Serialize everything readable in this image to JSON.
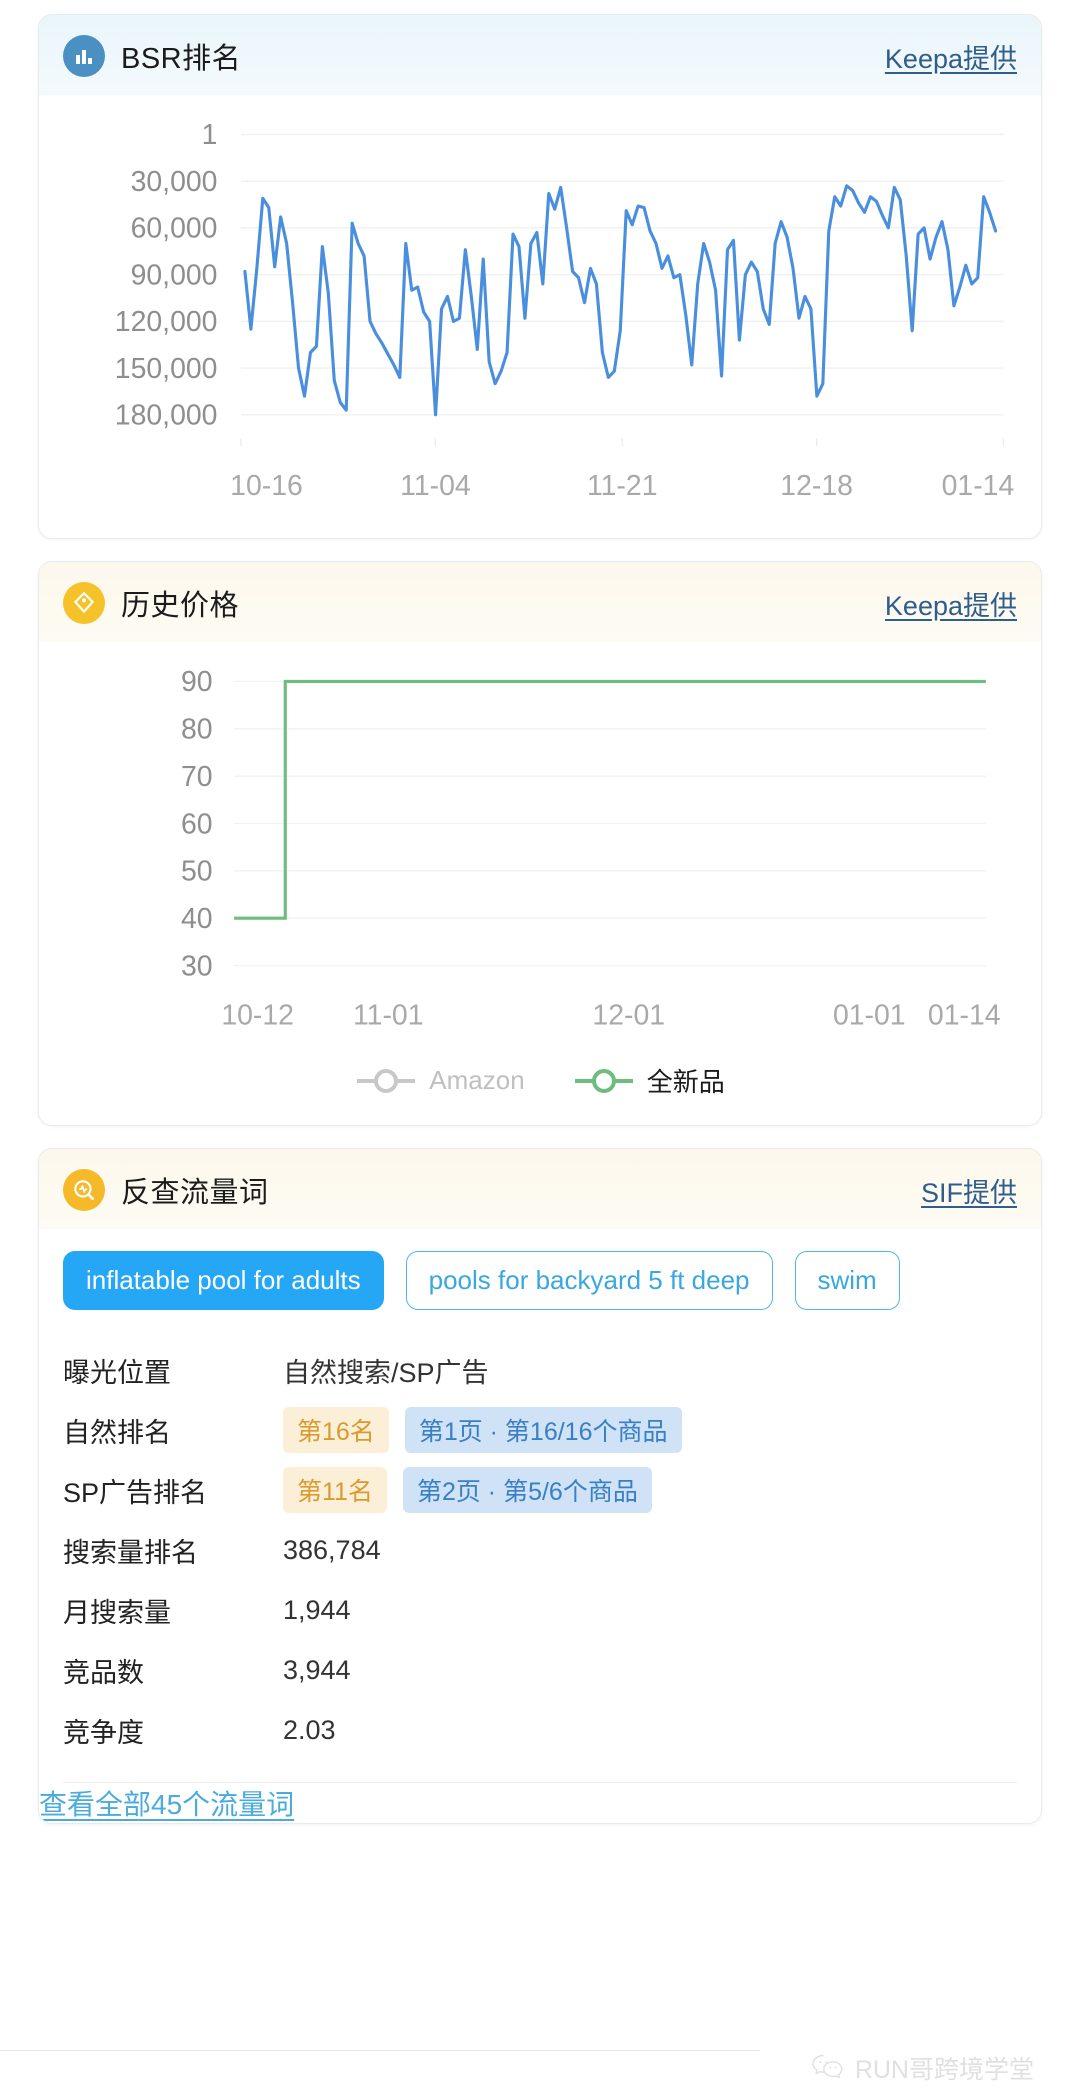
{
  "bsr_card": {
    "icon": "bar-chart-icon",
    "title": "BSR排名",
    "source_link": "Keepa提供"
  },
  "price_card": {
    "icon": "price-tag-icon",
    "title": "历史价格",
    "source_link": "Keepa提供",
    "legend": [
      {
        "name": "Amazon",
        "color": "#c8c8c8",
        "active": false
      },
      {
        "name": "全新品",
        "color": "#6cbd7e",
        "active": true
      }
    ]
  },
  "keyword_card": {
    "icon": "search-pulse-icon",
    "title": "反查流量词",
    "source_link": "SIF提供",
    "chips": [
      {
        "label": "inflatable pool for adults",
        "active": true
      },
      {
        "label": "pools for backyard 5 ft deep",
        "active": false
      },
      {
        "label": "swim",
        "active": false
      }
    ],
    "rows": [
      {
        "label": "曝光位置",
        "value": "自然搜索/SP广告",
        "tag_orange": "",
        "tag_blue": ""
      },
      {
        "label": "自然排名",
        "value": "",
        "tag_orange": "第16名",
        "tag_blue": "第1页 · 第16/16个商品"
      },
      {
        "label": "SP广告排名",
        "value": "",
        "tag_orange": "第11名",
        "tag_blue": "第2页 · 第5/6个商品"
      },
      {
        "label": "搜索量排名",
        "value": "386,784",
        "tag_orange": "",
        "tag_blue": ""
      },
      {
        "label": "月搜索量",
        "value": "1,944",
        "tag_orange": "",
        "tag_blue": ""
      },
      {
        "label": "竞品数",
        "value": "3,944",
        "tag_orange": "",
        "tag_blue": ""
      },
      {
        "label": "竞争度",
        "value": "2.03",
        "tag_orange": "",
        "tag_blue": ""
      }
    ],
    "view_all": "查看全部45个流量词"
  },
  "footer": {
    "watermark": "RUN哥跨境学堂",
    "icon": "wechat-icon"
  },
  "chart_data": [
    {
      "id": "bsr",
      "type": "line",
      "title": "BSR排名",
      "xlabel": "",
      "ylabel": "",
      "grid": true,
      "inverted_y": true,
      "line_color": "#4a8fdd",
      "ytick_labels": [
        "1",
        "30,000",
        "60,000",
        "90,000",
        "120,000",
        "150,000",
        "180,000"
      ],
      "ytick_values": [
        1,
        30000,
        60000,
        90000,
        120000,
        150000,
        180000
      ],
      "ylim": [
        1,
        195000
      ],
      "xtick_labels": [
        "10-16",
        "11-04",
        "11-21",
        "12-18",
        "01-14"
      ],
      "xtick_positions": [
        0,
        0.255,
        0.5,
        0.755,
        1.0
      ],
      "values": [
        88000,
        125000,
        86000,
        41000,
        47000,
        85000,
        53000,
        70000,
        108000,
        150000,
        168000,
        140000,
        136000,
        72000,
        102000,
        158000,
        172000,
        177000,
        57000,
        70000,
        78000,
        120000,
        128000,
        134000,
        141000,
        148000,
        156000,
        70000,
        100000,
        98000,
        114000,
        120000,
        180000,
        112000,
        104000,
        120000,
        118000,
        74000,
        104000,
        138000,
        80000,
        146000,
        160000,
        152000,
        140000,
        64000,
        72000,
        118000,
        70000,
        63000,
        96000,
        38000,
        48000,
        34000,
        60000,
        88000,
        92000,
        108000,
        86000,
        96000,
        140000,
        156000,
        152000,
        126000,
        49000,
        58000,
        46000,
        47000,
        62000,
        70000,
        86000,
        78000,
        92000,
        90000,
        116000,
        148000,
        96000,
        70000,
        82000,
        100000,
        155000,
        74000,
        68000,
        132000,
        90000,
        82000,
        88000,
        112000,
        122000,
        70000,
        56000,
        66000,
        86000,
        118000,
        104000,
        112000,
        168000,
        160000,
        62000,
        40000,
        46000,
        33000,
        36000,
        44000,
        50000,
        40000,
        43000,
        52000,
        60000,
        34000,
        42000,
        78000,
        126000,
        64000,
        60000,
        80000,
        66000,
        56000,
        74000,
        110000,
        98000,
        84000,
        96000,
        92000,
        40000,
        50000,
        62000
      ]
    },
    {
      "id": "price",
      "type": "line",
      "title": "历史价格",
      "xlabel": "",
      "ylabel": "",
      "grid": true,
      "line_color": "#6cbd7e",
      "step": true,
      "ytick_labels": [
        "90",
        "80",
        "70",
        "60",
        "50",
        "40",
        "30"
      ],
      "ytick_values": [
        90,
        80,
        70,
        60,
        50,
        40,
        30
      ],
      "ylim": [
        30,
        90
      ],
      "xtick_labels": [
        "10-12",
        "11-01",
        "12-01",
        "01-01",
        "01-14"
      ],
      "xtick_positions": [
        0,
        0.205,
        0.525,
        0.845,
        1.0
      ],
      "series": [
        {
          "name": "Amazon",
          "values": [],
          "visible": false
        },
        {
          "name": "全新品",
          "points": [
            [
              0,
              40
            ],
            [
              0.068,
              40
            ],
            [
              0.068,
              90
            ],
            [
              1.0,
              90
            ]
          ],
          "visible": true
        }
      ]
    }
  ]
}
